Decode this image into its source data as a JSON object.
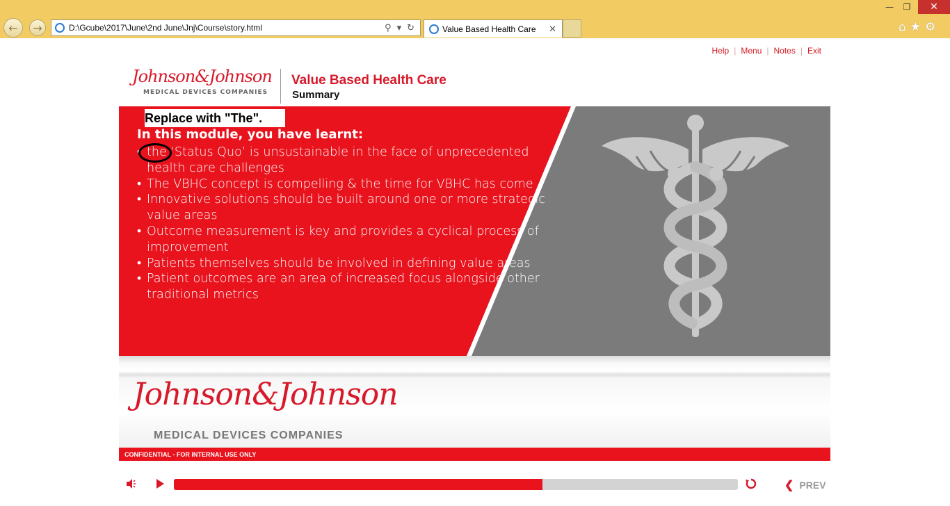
{
  "browser": {
    "address": "D:\\Gcube\\2017\\June\\2nd June\\Jnj\\Course\\story.html",
    "tab_title": "Value Based Health Care"
  },
  "toplinks": [
    "Help",
    "Menu",
    "Notes",
    "Exit"
  ],
  "header": {
    "logo_script": "Johnson&Johnson",
    "logo_sub": "MEDICAL DEVICES COMPANIES",
    "title": "Value Based Health Care",
    "subtitle": "Summary"
  },
  "slide": {
    "annotation": "Replace with \"The\".",
    "lead": "In this module, you have learnt:",
    "bullets": [
      "the ‘Status Quo’ is unsustainable in the face of unprecedented health care challenges",
      "The VBHC concept is compelling & the time for VBHC has come",
      "Innovative solutions should be built around one or more strategic value areas",
      "Outcome measurement is key and provides a cyclical process of improvement",
      "Patients themselves should be involved in defining value areas",
      "Patient outcomes are an area of increased focus alongside other traditional metrics"
    ]
  },
  "banner": {
    "logo_script": "Johnson&Johnson",
    "logo_sub": "MEDICAL DEVICES COMPANIES"
  },
  "confidential": "CONFIDENTIAL - FOR INTERNAL USE ONLY",
  "player": {
    "progress_fraction": 0.654,
    "prev_label": "PREV"
  },
  "colors": {
    "jnj_red": "#e8131d",
    "chrome_yellow": "#f3cb63",
    "slide_gray": "#7b7b7b"
  }
}
